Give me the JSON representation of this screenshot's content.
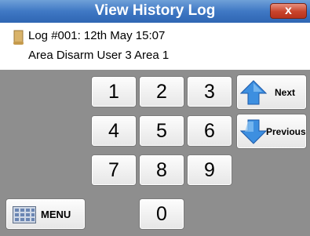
{
  "window": {
    "title": "View History Log",
    "close_label": "x"
  },
  "log": {
    "line1": "Log #001: 12th May 15:07",
    "line2": "Area Disarm  User 3  Area 1"
  },
  "keypad": {
    "k1": "1",
    "k2": "2",
    "k3": "3",
    "k4": "4",
    "k5": "5",
    "k6": "6",
    "k7": "7",
    "k8": "8",
    "k9": "9",
    "k0": "0"
  },
  "nav": {
    "next": "Next",
    "previous": "Previous"
  },
  "menu": {
    "label": "MENU"
  },
  "icons": {
    "scroll": "scroll-icon",
    "up": "arrow-up-icon",
    "down": "arrow-down-icon",
    "menu": "keypad-grid-icon"
  },
  "colors": {
    "titlebar": "#3f78c4",
    "close": "#c8432b",
    "panel": "#8e8e8e",
    "arrow": "#3d8fe0"
  }
}
